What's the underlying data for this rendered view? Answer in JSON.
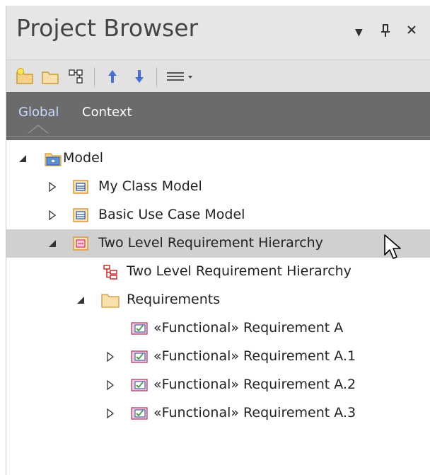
{
  "window": {
    "title": "Project Browser",
    "controls": {
      "dropdown_icon": "triangle-down-icon",
      "pin_icon": "pin-icon",
      "close_icon": "close-icon",
      "dropdown_glyph": "▼",
      "pin_glyph": "ᵽ",
      "close_glyph": "✕"
    }
  },
  "toolbar": {
    "buttons": [
      {
        "name": "new-model-icon"
      },
      {
        "name": "new-package-icon"
      },
      {
        "name": "new-diagram-icon"
      },
      {
        "name": "move-up-icon"
      },
      {
        "name": "move-down-icon"
      },
      {
        "name": "menu-icon"
      }
    ]
  },
  "tabs": [
    {
      "label": "Global",
      "active": true
    },
    {
      "label": "Context",
      "active": false
    }
  ],
  "tree": {
    "items": [
      {
        "label": "Model",
        "level": 0,
        "expander": "expanded",
        "icon": "model-root-icon"
      },
      {
        "label": "My Class Model",
        "level": 1,
        "expander": "collapsed",
        "icon": "package-icon"
      },
      {
        "label": "Basic Use Case Model",
        "level": 1,
        "expander": "collapsed",
        "icon": "package-icon"
      },
      {
        "label": "Two Level Requirement Hierarchy",
        "level": 1,
        "expander": "expanded",
        "icon": "requirement-package-icon",
        "selected": true
      },
      {
        "label": "Two Level Requirement Hierarchy",
        "level": 2,
        "expander": "none",
        "icon": "diagram-icon"
      },
      {
        "label": "Requirements",
        "level": 2,
        "expander": "expanded",
        "icon": "folder-icon"
      },
      {
        "label": "«Functional» Requirement A",
        "level": 3,
        "expander": "none",
        "icon": "requirement-icon"
      },
      {
        "label": "«Functional» Requirement A.1",
        "level": 3,
        "expander": "collapsed",
        "icon": "requirement-icon"
      },
      {
        "label": "«Functional» Requirement A.2",
        "level": 3,
        "expander": "collapsed",
        "icon": "requirement-icon"
      },
      {
        "label": "«Functional» Requirement A.3",
        "level": 3,
        "expander": "collapsed",
        "icon": "requirement-icon"
      }
    ]
  },
  "colors": {
    "title_bar": "#e6e6e6",
    "tab_bar": "#6b6b6b",
    "active_tab": "#c8d8ff",
    "selection": "#d0d0d0",
    "toolbar_arrow": "#4a6fd0"
  }
}
